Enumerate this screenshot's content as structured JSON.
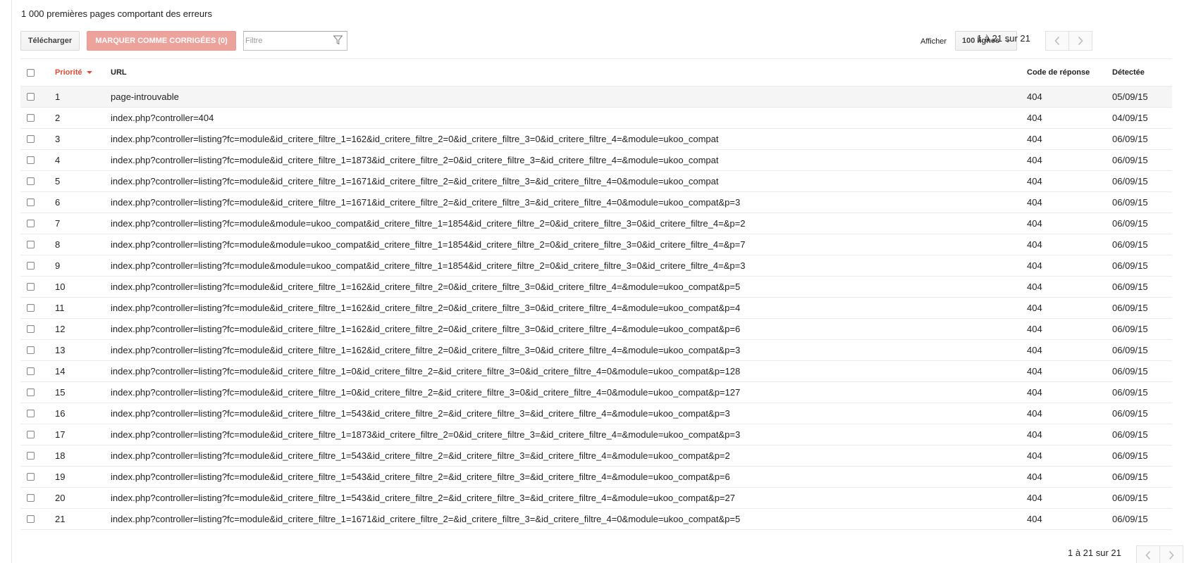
{
  "heading": "1 000 premières pages comportant des erreurs",
  "toolbar": {
    "download_label": "Télécharger",
    "mark_label": "MARQUER COMME CORRIGÉES (0)",
    "filter_placeholder": "Filtre",
    "show_label": "Afficher",
    "rows_selected": "100 lignes"
  },
  "pagination": {
    "top_range": "1 à 21 sur 21",
    "bottom_range": "1 à 21 sur 21"
  },
  "colors": {
    "sort_accent": "#dd4b39",
    "mark_button": "#eba39c"
  },
  "table": {
    "columns": {
      "priority": "Priorité",
      "url": "URL",
      "code": "Code de réponse",
      "detected": "Détectée"
    },
    "sort": {
      "column": "Priorité",
      "direction": "descending"
    },
    "rows": [
      {
        "priority": "1",
        "url": "page-introuvable",
        "code": "404",
        "detected": "05/09/15"
      },
      {
        "priority": "2",
        "url": "index.php?controller=404",
        "code": "404",
        "detected": "04/09/15"
      },
      {
        "priority": "3",
        "url": "index.php?controller=listing?fc=module&id_critere_filtre_1=162&id_critere_filtre_2=0&id_critere_filtre_3=0&id_critere_filtre_4=&module=ukoo_compat",
        "code": "404",
        "detected": "06/09/15"
      },
      {
        "priority": "4",
        "url": "index.php?controller=listing?fc=module&id_critere_filtre_1=1873&id_critere_filtre_2=0&id_critere_filtre_3=&id_critere_filtre_4=&module=ukoo_compat",
        "code": "404",
        "detected": "06/09/15"
      },
      {
        "priority": "5",
        "url": "index.php?controller=listing?fc=module&id_critere_filtre_1=1671&id_critere_filtre_2=&id_critere_filtre_3=&id_critere_filtre_4=0&module=ukoo_compat",
        "code": "404",
        "detected": "06/09/15"
      },
      {
        "priority": "6",
        "url": "index.php?controller=listing?fc=module&id_critere_filtre_1=1671&id_critere_filtre_2=&id_critere_filtre_3=&id_critere_filtre_4=0&module=ukoo_compat&p=3",
        "code": "404",
        "detected": "06/09/15"
      },
      {
        "priority": "7",
        "url": "index.php?controller=listing?fc=module&module=ukoo_compat&id_critere_filtre_1=1854&id_critere_filtre_2=0&id_critere_filtre_3=0&id_critere_filtre_4=&p=2",
        "code": "404",
        "detected": "06/09/15"
      },
      {
        "priority": "8",
        "url": "index.php?controller=listing?fc=module&module=ukoo_compat&id_critere_filtre_1=1854&id_critere_filtre_2=0&id_critere_filtre_3=0&id_critere_filtre_4=&p=7",
        "code": "404",
        "detected": "06/09/15"
      },
      {
        "priority": "9",
        "url": "index.php?controller=listing?fc=module&module=ukoo_compat&id_critere_filtre_1=1854&id_critere_filtre_2=0&id_critere_filtre_3=0&id_critere_filtre_4=&p=3",
        "code": "404",
        "detected": "06/09/15"
      },
      {
        "priority": "10",
        "url": "index.php?controller=listing?fc=module&id_critere_filtre_1=162&id_critere_filtre_2=0&id_critere_filtre_3=0&id_critere_filtre_4=&module=ukoo_compat&p=5",
        "code": "404",
        "detected": "06/09/15"
      },
      {
        "priority": "11",
        "url": "index.php?controller=listing?fc=module&id_critere_filtre_1=162&id_critere_filtre_2=0&id_critere_filtre_3=0&id_critere_filtre_4=&module=ukoo_compat&p=4",
        "code": "404",
        "detected": "06/09/15"
      },
      {
        "priority": "12",
        "url": "index.php?controller=listing?fc=module&id_critere_filtre_1=162&id_critere_filtre_2=0&id_critere_filtre_3=0&id_critere_filtre_4=&module=ukoo_compat&p=6",
        "code": "404",
        "detected": "06/09/15"
      },
      {
        "priority": "13",
        "url": "index.php?controller=listing?fc=module&id_critere_filtre_1=162&id_critere_filtre_2=0&id_critere_filtre_3=0&id_critere_filtre_4=&module=ukoo_compat&p=3",
        "code": "404",
        "detected": "06/09/15"
      },
      {
        "priority": "14",
        "url": "index.php?controller=listing?fc=module&id_critere_filtre_1=0&id_critere_filtre_2=&id_critere_filtre_3=0&id_critere_filtre_4=0&module=ukoo_compat&p=128",
        "code": "404",
        "detected": "06/09/15"
      },
      {
        "priority": "15",
        "url": "index.php?controller=listing?fc=module&id_critere_filtre_1=0&id_critere_filtre_2=&id_critere_filtre_3=0&id_critere_filtre_4=0&module=ukoo_compat&p=127",
        "code": "404",
        "detected": "06/09/15"
      },
      {
        "priority": "16",
        "url": "index.php?controller=listing?fc=module&id_critere_filtre_1=543&id_critere_filtre_2=&id_critere_filtre_3=&id_critere_filtre_4=&module=ukoo_compat&p=3",
        "code": "404",
        "detected": "06/09/15"
      },
      {
        "priority": "17",
        "url": "index.php?controller=listing?fc=module&id_critere_filtre_1=1873&id_critere_filtre_2=0&id_critere_filtre_3=&id_critere_filtre_4=&module=ukoo_compat&p=3",
        "code": "404",
        "detected": "06/09/15"
      },
      {
        "priority": "18",
        "url": "index.php?controller=listing?fc=module&id_critere_filtre_1=543&id_critere_filtre_2=&id_critere_filtre_3=&id_critere_filtre_4=&module=ukoo_compat&p=2",
        "code": "404",
        "detected": "06/09/15"
      },
      {
        "priority": "19",
        "url": "index.php?controller=listing?fc=module&id_critere_filtre_1=543&id_critere_filtre_2=&id_critere_filtre_3=&id_critere_filtre_4=&module=ukoo_compat&p=6",
        "code": "404",
        "detected": "06/09/15"
      },
      {
        "priority": "20",
        "url": "index.php?controller=listing?fc=module&id_critere_filtre_1=543&id_critere_filtre_2=&id_critere_filtre_3=&id_critere_filtre_4=&module=ukoo_compat&p=27",
        "code": "404",
        "detected": "06/09/15"
      },
      {
        "priority": "21",
        "url": "index.php?controller=listing?fc=module&id_critere_filtre_1=1671&id_critere_filtre_2=&id_critere_filtre_3=&id_critere_filtre_4=0&module=ukoo_compat&p=5",
        "code": "404",
        "detected": "06/09/15"
      }
    ]
  }
}
